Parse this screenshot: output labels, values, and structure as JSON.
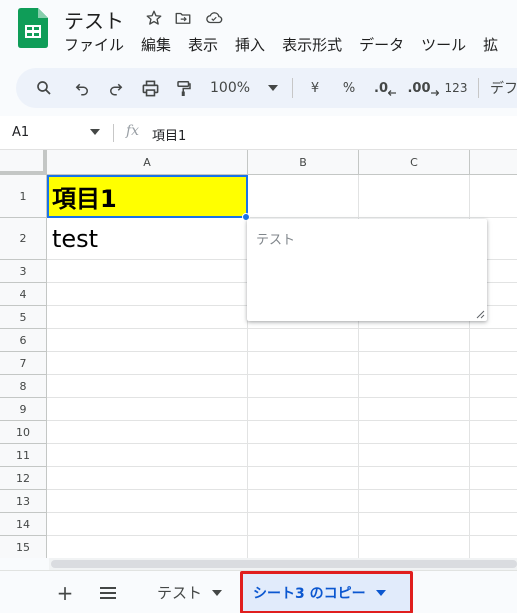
{
  "app": {
    "title": "テスト",
    "brand_color": "#0f9d58"
  },
  "title_icons": [
    "star-icon",
    "move-to-folder-icon",
    "cloud-status-icon"
  ],
  "menu": [
    "ファイル",
    "編集",
    "表示",
    "挿入",
    "表示形式",
    "データ",
    "ツール",
    "拡"
  ],
  "toolbar": {
    "zoom": "100%",
    "currency": "¥",
    "percent": "%",
    "decrease_decimal": ".0",
    "increase_decimal": ".00",
    "number_format": "123",
    "font_partial": "デフ",
    "icons": [
      "search-icon",
      "undo-icon",
      "redo-icon",
      "print-icon",
      "paint-format-icon"
    ]
  },
  "formula_bar": {
    "cell_ref": "A1",
    "fx": "fx",
    "value": "項目1"
  },
  "grid": {
    "columns": [
      "A",
      "B",
      "C"
    ],
    "rows": [
      "1",
      "2",
      "3",
      "4",
      "5",
      "6",
      "7",
      "8",
      "9",
      "10",
      "11",
      "12",
      "13",
      "14",
      "15"
    ],
    "cells": {
      "A1": "項目1",
      "A2": "test"
    },
    "highlight_color": "#ffff00",
    "selection_color": "#1a73e8"
  },
  "note": {
    "placeholder": "テスト"
  },
  "sheet_tabs": {
    "add_label": "+",
    "all_sheets_label": "≡",
    "tabs": [
      {
        "label": "テスト",
        "active": false
      },
      {
        "label": "シート3 のコピー",
        "active": true
      }
    ],
    "active_color": "#0b57d0",
    "highlight_border": "#e01e1e"
  }
}
